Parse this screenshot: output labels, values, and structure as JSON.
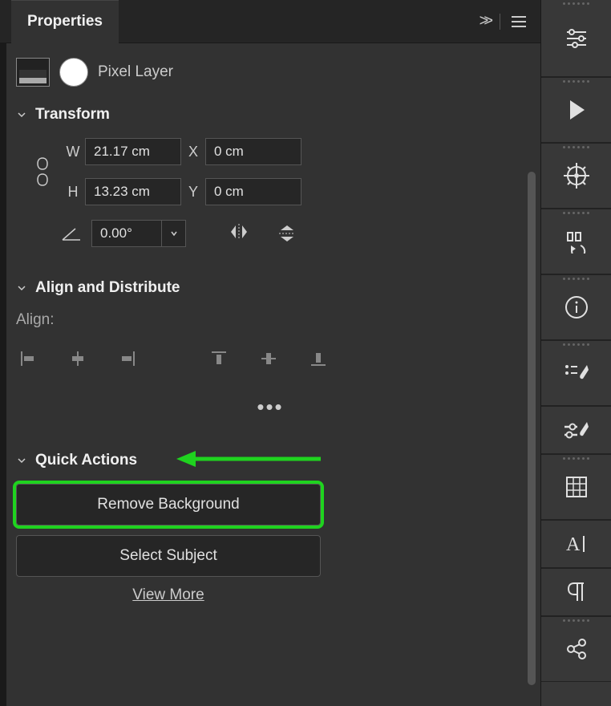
{
  "panel": {
    "title": "Properties",
    "layer_type": "Pixel Layer"
  },
  "transform": {
    "heading": "Transform",
    "w_label": "W",
    "h_label": "H",
    "x_label": "X",
    "y_label": "Y",
    "w_value": "21.17 cm",
    "h_value": "13.23 cm",
    "x_value": "0 cm",
    "y_value": "0 cm",
    "rotation": "0.00°"
  },
  "align": {
    "heading": "Align and Distribute",
    "label": "Align:"
  },
  "quick_actions": {
    "heading": "Quick Actions",
    "remove_bg": "Remove Background",
    "select_subject": "Select Subject",
    "view_more": "View More"
  },
  "annotation": {
    "highlight_color": "#1fd31f"
  }
}
